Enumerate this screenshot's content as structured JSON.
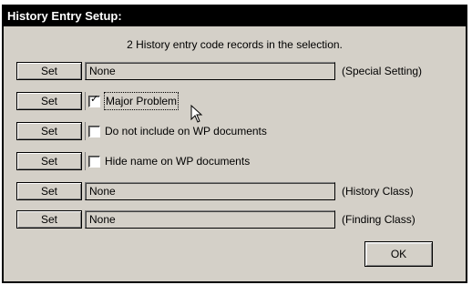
{
  "window": {
    "title": "History Entry Setup:"
  },
  "selection_info": "2 History entry code records in the selection.",
  "set_label": "Set",
  "rows": [
    {
      "kind": "field",
      "value": "None",
      "label": "(Special Setting)"
    },
    {
      "kind": "checkbox",
      "checked": true,
      "label": "Major Problem"
    },
    {
      "kind": "checkbox",
      "checked": false,
      "label": "Do not include on WP documents"
    },
    {
      "kind": "checkbox",
      "checked": false,
      "label": "Hide name on WP documents"
    },
    {
      "kind": "field",
      "value": "None",
      "label": "(History Class)"
    },
    {
      "kind": "field",
      "value": "None",
      "label": "(Finding Class)"
    }
  ],
  "check_mark": "✓",
  "ok_label": "OK",
  "icons": {
    "cursor": "arrow-pointer-icon"
  }
}
